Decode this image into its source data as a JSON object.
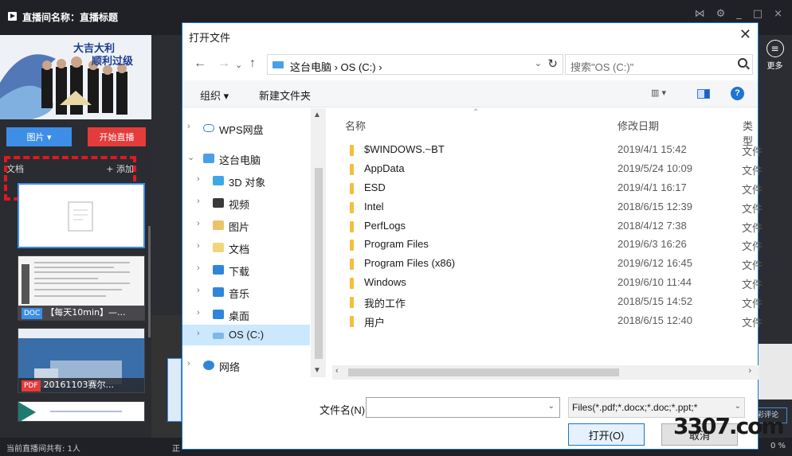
{
  "app": {
    "title": "直播间名称：直播标题",
    "window_icons": [
      "share-icon",
      "gear-icon",
      "minimize-icon",
      "maximize-icon",
      "close-icon"
    ],
    "banner_line1": "大吉大利",
    "banner_line2": "顺利过级",
    "image_button": "图片 ▾",
    "start_live_button": "开始直播",
    "docs_label": "文档",
    "add_label": "+ 添加",
    "thumbs": [
      {
        "tag": "",
        "caption": ""
      },
      {
        "tag": "DOC",
        "caption": "【每天10min】—..."
      },
      {
        "tag": "PDF",
        "caption": "20161103赛尔..."
      }
    ],
    "status_left": "当前直播间共有: 1人",
    "status_mid": "正",
    "status_right": "0 %",
    "more_label": "更多",
    "comment_label": "精彩评论"
  },
  "dialog": {
    "title": "打开文件",
    "address": "这台电脑 › OS (C:) ›",
    "search_placeholder": "搜索\"OS (C:)\"",
    "toolbar": {
      "organize": "组织 ▾",
      "new_folder": "新建文件夹",
      "view": "▥ ▾"
    },
    "tree": [
      {
        "label": "WPS网盘",
        "icon": "cloud-icon",
        "color": "#ffffff",
        "expand": "›"
      },
      {
        "label": "这台电脑",
        "icon": "computer-icon",
        "color": "#4aa0e8",
        "expand": "⌄"
      },
      {
        "label": "3D 对象",
        "icon": "3d-objects-icon",
        "color": "#3fa7e8",
        "expand": "›"
      },
      {
        "label": "视频",
        "icon": "video-icon",
        "color": "#3a3a3a",
        "expand": "›"
      },
      {
        "label": "图片",
        "icon": "picture-icon",
        "color": "#e9c46a",
        "expand": "›"
      },
      {
        "label": "文档",
        "icon": "document-icon",
        "color": "#f0d67a",
        "expand": "›"
      },
      {
        "label": "下载",
        "icon": "download-icon",
        "color": "#2f86d9",
        "expand": "›"
      },
      {
        "label": "音乐",
        "icon": "music-icon",
        "color": "#2f86d9",
        "expand": "›"
      },
      {
        "label": "桌面",
        "icon": "desktop-icon",
        "color": "#2f86d9",
        "expand": "›"
      },
      {
        "label": "OS (C:)",
        "icon": "drive-icon",
        "color": "#7fb8e8",
        "expand": "›"
      },
      {
        "label": "网络",
        "icon": "network-icon",
        "color": "#2f86d9",
        "expand": "›"
      }
    ],
    "columns": {
      "name": "名称",
      "date": "修改日期",
      "type": "类型"
    },
    "files": [
      {
        "name": "$WINDOWS.~BT",
        "date": "2019/4/1 15:42",
        "type": "文件"
      },
      {
        "name": "AppData",
        "date": "2019/5/24 10:09",
        "type": "文件"
      },
      {
        "name": "ESD",
        "date": "2019/4/1 16:17",
        "type": "文件"
      },
      {
        "name": "Intel",
        "date": "2018/6/15 12:39",
        "type": "文件"
      },
      {
        "name": "PerfLogs",
        "date": "2018/4/12 7:38",
        "type": "文件"
      },
      {
        "name": "Program Files",
        "date": "2019/6/3 16:26",
        "type": "文件"
      },
      {
        "name": "Program Files (x86)",
        "date": "2019/6/12 16:45",
        "type": "文件"
      },
      {
        "name": "Windows",
        "date": "2019/6/10 11:44",
        "type": "文件"
      },
      {
        "name": "我的工作",
        "date": "2018/5/15 14:52",
        "type": "文件"
      },
      {
        "name": "用户",
        "date": "2018/6/15 12:40",
        "type": "文件"
      }
    ],
    "filename_label": "文件名(N):",
    "filename_value": "",
    "filter_value": "Files(*.pdf;*.docx;*.doc;*.ppt;*",
    "open_button": "打开(O)",
    "cancel_button": "取消"
  },
  "watermark": "3307.com"
}
